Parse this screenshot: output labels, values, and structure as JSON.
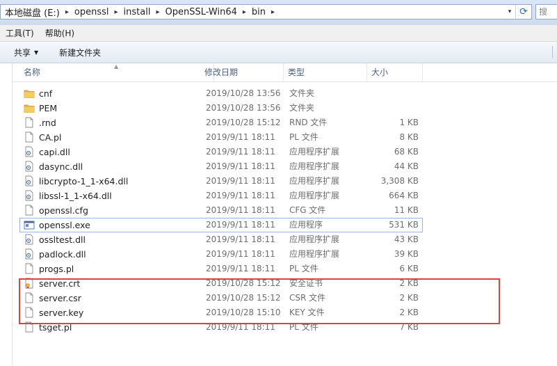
{
  "address": {
    "crumbs": [
      "本地磁盘 (E:)",
      "openssl",
      "install",
      "OpenSSL-Win64",
      "bin"
    ],
    "dropdown_glyph": "▾",
    "refresh_glyph": "⟳"
  },
  "search": {
    "placeholder": "搜"
  },
  "menubar": {
    "items": [
      "工具(T)",
      "帮助(H)"
    ]
  },
  "toolbar": {
    "share_label": "共享",
    "new_folder_label": "新建文件夹"
  },
  "columns": {
    "name": "名称",
    "date": "修改日期",
    "type": "类型",
    "size": "大小"
  },
  "files": [
    {
      "name": "cnf",
      "date": "2019/10/28 13:56",
      "type": "文件夹",
      "size": "",
      "icon": "folder-icon"
    },
    {
      "name": "PEM",
      "date": "2019/10/28 13:56",
      "type": "文件夹",
      "size": "",
      "icon": "folder-icon"
    },
    {
      "name": ".rnd",
      "date": "2019/10/28 15:12",
      "type": "RND 文件",
      "size": "1 KB",
      "icon": "file-icon"
    },
    {
      "name": "CA.pl",
      "date": "2019/9/11 18:11",
      "type": "PL 文件",
      "size": "8 KB",
      "icon": "file-icon"
    },
    {
      "name": "capi.dll",
      "date": "2019/9/11 18:11",
      "type": "应用程序扩展",
      "size": "68 KB",
      "icon": "dll-icon"
    },
    {
      "name": "dasync.dll",
      "date": "2019/9/11 18:11",
      "type": "应用程序扩展",
      "size": "44 KB",
      "icon": "dll-icon"
    },
    {
      "name": "libcrypto-1_1-x64.dll",
      "date": "2019/9/11 18:11",
      "type": "应用程序扩展",
      "size": "3,308 KB",
      "icon": "dll-icon"
    },
    {
      "name": "libssl-1_1-x64.dll",
      "date": "2019/9/11 18:11",
      "type": "应用程序扩展",
      "size": "664 KB",
      "icon": "dll-icon"
    },
    {
      "name": "openssl.cfg",
      "date": "2019/9/11 18:11",
      "type": "CFG 文件",
      "size": "11 KB",
      "icon": "file-icon"
    },
    {
      "name": "openssl.exe",
      "date": "2019/9/11 18:11",
      "type": "应用程序",
      "size": "531 KB",
      "icon": "exe-icon"
    },
    {
      "name": "ossltest.dll",
      "date": "2019/9/11 18:11",
      "type": "应用程序扩展",
      "size": "43 KB",
      "icon": "dll-icon"
    },
    {
      "name": "padlock.dll",
      "date": "2019/9/11 18:11",
      "type": "应用程序扩展",
      "size": "39 KB",
      "icon": "dll-icon"
    },
    {
      "name": "progs.pl",
      "date": "2019/9/11 18:11",
      "type": "PL 文件",
      "size": "6 KB",
      "icon": "file-icon"
    },
    {
      "name": "server.crt",
      "date": "2019/10/28 15:12",
      "type": "安全证书",
      "size": "2 KB",
      "icon": "certificate-icon"
    },
    {
      "name": "server.csr",
      "date": "2019/10/28 15:12",
      "type": "CSR 文件",
      "size": "2 KB",
      "icon": "file-icon"
    },
    {
      "name": "server.key",
      "date": "2019/10/28 15:10",
      "type": "KEY 文件",
      "size": "2 KB",
      "icon": "file-icon"
    },
    {
      "name": "tsget.pl",
      "date": "2019/9/11 18:11",
      "type": "PL 文件",
      "size": "7 KB",
      "icon": "file-icon"
    }
  ],
  "selected_file": "openssl.exe",
  "colors": {
    "folder": "#e8b84a",
    "highlight": "#e04040",
    "selection": "#9ab6dc"
  }
}
